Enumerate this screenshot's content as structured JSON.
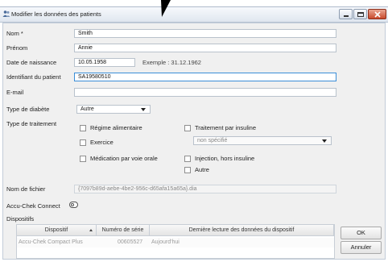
{
  "window": {
    "title": "Modifier les données des patients",
    "icon": "people-icon"
  },
  "form": {
    "nom": {
      "label": "Nom *",
      "value": "Smith"
    },
    "prenom": {
      "label": "Prénom",
      "value": "Annie"
    },
    "dob": {
      "label": "Date de naissance",
      "value": "10.05.1958",
      "example": "Exemple : 31.12.1962"
    },
    "patient_id": {
      "label": "Identifiant du patient",
      "value": "SA19580510"
    },
    "email": {
      "label": "E-mail",
      "value": ""
    },
    "diabetes_type": {
      "label": "Type de diabète",
      "value": "Autre"
    },
    "treatment": {
      "label": "Type de traitement",
      "options": {
        "diet": "Régime alimentaire",
        "exercise": "Exercice",
        "oral": "Médication par voie orale",
        "insulin": "Traitement par insuline",
        "insulin_select": "non spécifié",
        "injection": "Injection, hors insuline",
        "other": "Autre"
      }
    },
    "filename": {
      "label": "Nom de fichier",
      "value": "{7097b89d-aebe-4be2-956c-d65afa15a65a}.dia"
    },
    "accu_connect": {
      "label": "Accu-Chek Connect"
    },
    "devices": {
      "label": "Dispositifs",
      "columns": [
        "Dispositif",
        "Numéro de série",
        "Dernière lecture des données du dispositif"
      ],
      "rows": [
        {
          "device": "Accu-Chek Compact Plus",
          "serial": "00605527",
          "last_read": "Aujourd'hui"
        }
      ]
    }
  },
  "buttons": {
    "ok": "OK",
    "cancel": "Annuler"
  }
}
